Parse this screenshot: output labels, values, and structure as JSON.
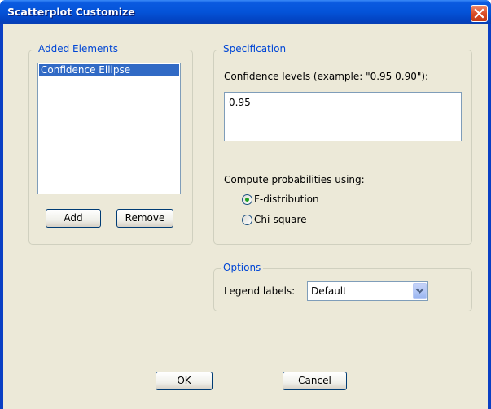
{
  "window": {
    "title": "Scatterplot Customize"
  },
  "added_elements": {
    "legend": "Added Elements",
    "items": [
      "Confidence Ellipse"
    ],
    "add_label": "Add",
    "remove_label": "Remove"
  },
  "specification": {
    "legend": "Specification",
    "confidence_label": "Confidence levels (example: \"0.95 0.90\"):",
    "confidence_value": "0.95",
    "compute_label": "Compute probabilities using:",
    "options": [
      "F-distribution",
      "Chi-square"
    ],
    "selected": "F-distribution"
  },
  "options": {
    "legend": "Options",
    "legend_labels_label": "Legend labels:",
    "legend_labels_value": "Default"
  },
  "footer": {
    "ok_label": "OK",
    "cancel_label": "Cancel"
  },
  "icons": {
    "close": "close-x-icon",
    "dropdown": "chevron-down-icon"
  },
  "colors": {
    "titlebar": "#0453d8",
    "accent": "#0046d5",
    "selection": "#316ac5",
    "dialog_bg": "#ece9d8"
  }
}
